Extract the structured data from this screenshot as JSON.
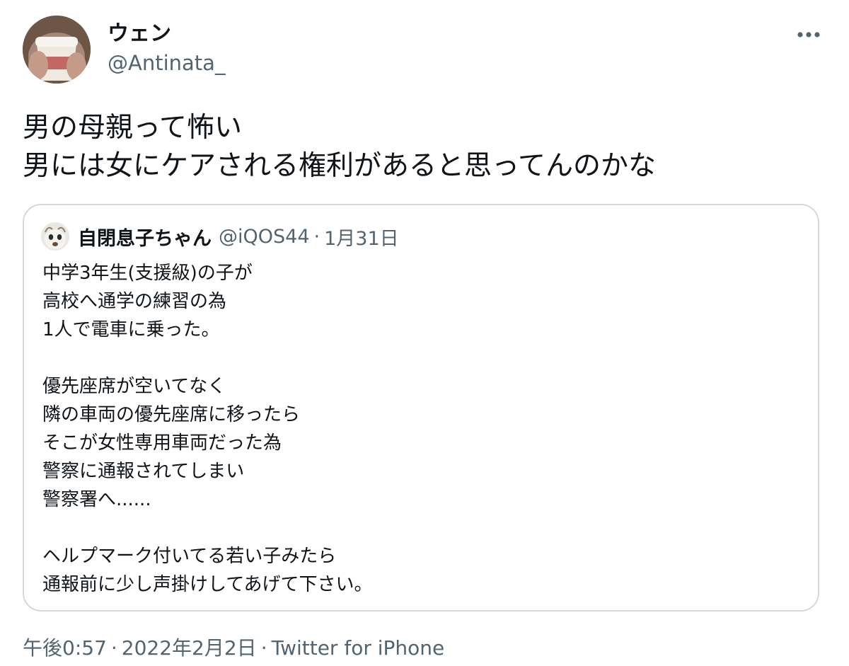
{
  "tweet": {
    "author": {
      "display_name": "ウェン",
      "handle": "@Antinata_",
      "avatar": "user-avatar"
    },
    "more_icon": "more-horizontal-icon",
    "text_lines": [
      "男の母親って怖い",
      "男には女にケアされる権利があると思ってんのかな"
    ],
    "timestamp": {
      "time": "午後0:57",
      "separator": "·",
      "date": "2022年2月2日",
      "source": "Twitter for iPhone"
    }
  },
  "quoted_tweet": {
    "display_name": "自閉息子ちゃん",
    "handle": "@iQOS44",
    "separator": "·",
    "date": "1月31日",
    "body_lines": [
      "中学3年生(支援級)の子が",
      "高校へ通学の練習の為",
      "1人で電車に乗った。",
      "",
      "優先座席が空いてなく",
      "隣の車両の優先座席に移ったら",
      "そこが女性専用車両だった為",
      "警察に通報されてしまい",
      "警察署へ......",
      "",
      "ヘルプマーク付いてる若い子みたら",
      "通報前に少し声掛けしてあげて下さい。"
    ]
  },
  "colors": {
    "text_primary": "#0f1419",
    "text_secondary": "#536471",
    "border": "#cfd9de"
  }
}
